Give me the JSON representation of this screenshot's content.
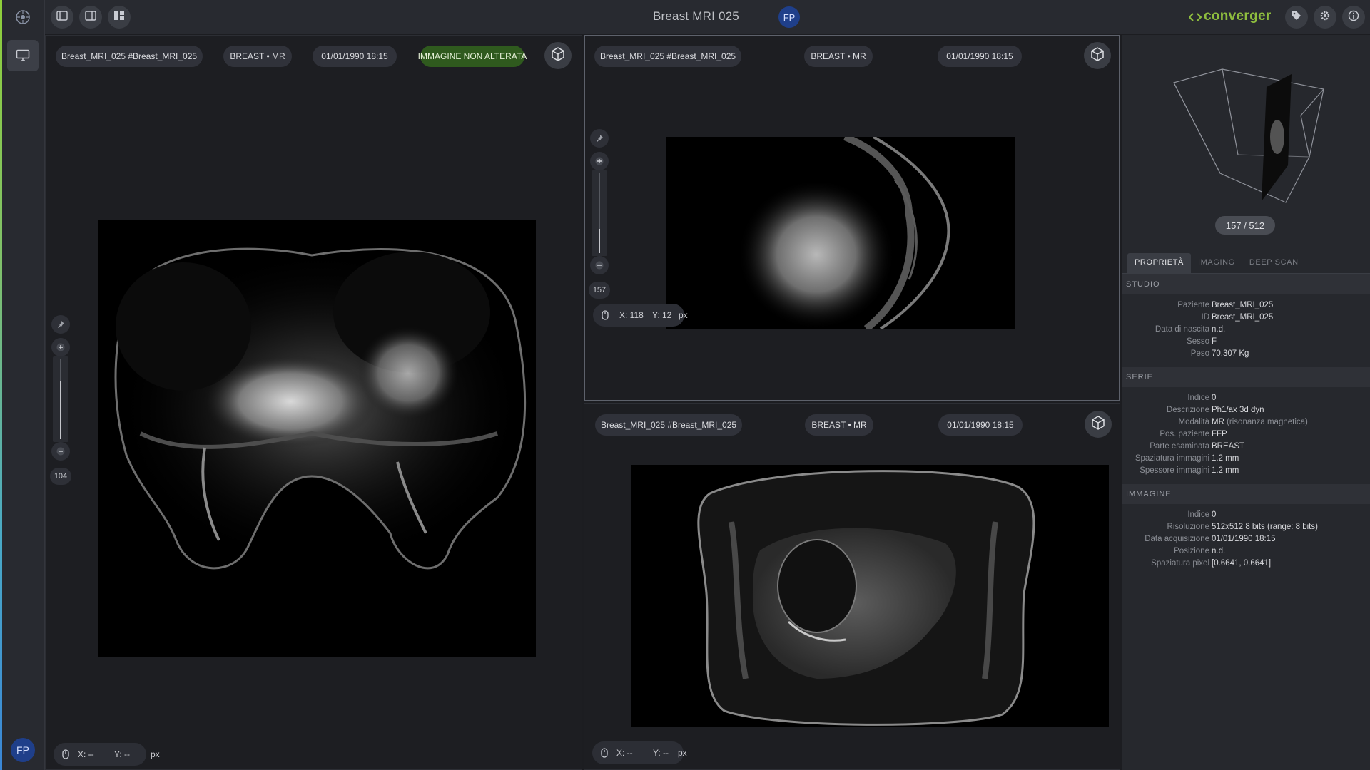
{
  "app": {
    "title": "Breast MRI 025",
    "user_initials": "FP",
    "brand": "converger"
  },
  "viewports": {
    "main": {
      "series_label": "Breast_MRI_025 #Breast_MRI_025",
      "modality_label": "BREAST • MR",
      "datetime": "01/01/1990 18:15",
      "status_badge": "IMMAGINE NON ALTERATA",
      "slice_value": "104",
      "slice_fraction": 0.72,
      "coords": {
        "x": "X: --",
        "y": "Y: --",
        "unit": "px"
      }
    },
    "top_right": {
      "series_label": "Breast_MRI_025 #Breast_MRI_025",
      "modality_label": "BREAST • MR",
      "datetime": "01/01/1990 18:15",
      "slice_value": "157",
      "slice_fraction": 0.3,
      "coords": {
        "x": "X: 118",
        "y": "Y: 12",
        "unit": "px"
      }
    },
    "bottom_right": {
      "series_label": "Breast_MRI_025 #Breast_MRI_025",
      "modality_label": "BREAST • MR",
      "datetime": "01/01/1990 18:15",
      "coords": {
        "x": "X: --",
        "y": "Y: --",
        "unit": "px"
      }
    }
  },
  "volume_preview": {
    "slice_counter": "157 / 512"
  },
  "tabs": [
    "PROPRIETÀ",
    "IMAGING",
    "DEEP SCAN"
  ],
  "properties": {
    "study": {
      "title": "STUDIO",
      "rows": [
        {
          "k": "Paziente",
          "v": "Breast_MRI_025"
        },
        {
          "k": "ID",
          "v": "Breast_MRI_025"
        },
        {
          "k": "Data di nascita",
          "v": "n.d."
        },
        {
          "k": "Sesso",
          "v": "F"
        },
        {
          "k": "Peso",
          "v": "70.307 Kg"
        }
      ]
    },
    "series": {
      "title": "SERIE",
      "rows": [
        {
          "k": "Indice",
          "v": "0"
        },
        {
          "k": "Descrizione",
          "v": "Ph1/ax 3d dyn"
        },
        {
          "k": "Modalità",
          "v": "MR",
          "note": "(risonanza magnetica)"
        },
        {
          "k": "Pos. paziente",
          "v": "FFP"
        },
        {
          "k": "Parte esaminata",
          "v": "BREAST"
        },
        {
          "k": "Spaziatura immagini",
          "v": "1.2 mm"
        },
        {
          "k": "Spessore immagini",
          "v": "1.2 mm"
        }
      ]
    },
    "image": {
      "title": "IMMAGINE",
      "rows": [
        {
          "k": "Indice",
          "v": "0"
        },
        {
          "k": "Risoluzione",
          "v": "512x512 8 bits (range: 8 bits)"
        },
        {
          "k": "Data acquisizione",
          "v": "01/01/1990 18:15"
        },
        {
          "k": "Posizione",
          "v": "n.d."
        },
        {
          "k": "Spaziatura pixel",
          "v": "[0.6641, 0.6641]"
        }
      ]
    }
  },
  "colors": {
    "accent_green": "#8ebd3e",
    "avatar_blue": "#1f3f8a",
    "badge_green": "#2f5a1e"
  },
  "icons": [
    "logo-icon",
    "monitor-icon",
    "layout-single-icon",
    "layout-two-icon",
    "layout-grid-icon",
    "cube-icon",
    "pin-icon",
    "plus-icon",
    "minus-icon",
    "mouse-icon",
    "tag-icon",
    "settings-icon",
    "info-icon"
  ]
}
